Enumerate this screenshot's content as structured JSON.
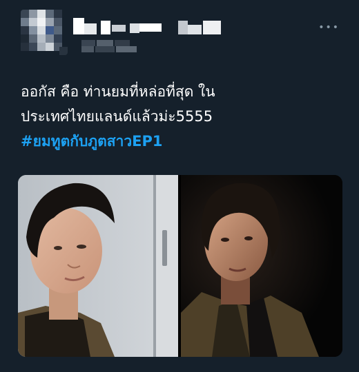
{
  "tweet": {
    "text_lines": [
      "ออกัส คือ ท่านยมที่หล่อที่สุด ใน",
      "ประเทศไทยแลนด์แล้วม่ะ5555"
    ],
    "hashtag": "#ยมทูตกับภูตสาวEP1",
    "more_label": "•••",
    "media_count": 2
  },
  "colors": {
    "background": "#15202b",
    "text": "#ffffff",
    "link": "#1da1f2",
    "muted": "#8899a6"
  },
  "icons": {
    "more": "more-horizontal-icon"
  }
}
